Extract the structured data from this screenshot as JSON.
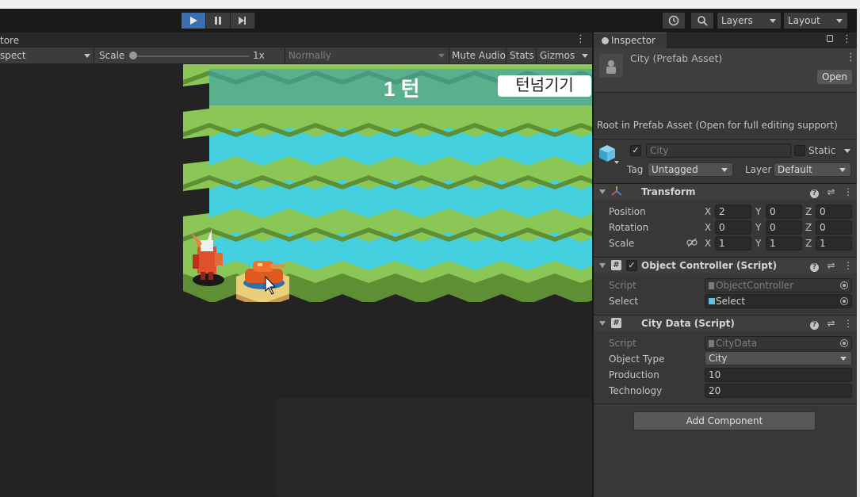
{
  "toolbar": {
    "play_icon": "play-icon",
    "pause_icon": "pause-icon",
    "step_icon": "step-icon",
    "history_icon": "history-icon",
    "search_icon": "search-icon",
    "layers_label": "Layers",
    "layout_label": "Layout"
  },
  "game_view": {
    "tab_label": "tore",
    "aspect_label": "spect",
    "scale_label": "Scale",
    "scale_value": "1x",
    "quality_label": "Normally",
    "mute_label": "Mute Audio",
    "stats_label": "Stats",
    "gizmos_label": "Gizmos",
    "turn_text": "1 턴",
    "skip_button": "턴넘기기"
  },
  "inspector": {
    "tab_label": "Inspector",
    "header_title": "City (Prefab Asset)",
    "open_button": "Open",
    "root_message": "Root in Prefab Asset (Open for full editing support)",
    "object_name": "City",
    "active": true,
    "static_label": "Static",
    "tag_label": "Tag",
    "tag_value": "Untagged",
    "layer_label": "Layer",
    "layer_value": "Default",
    "transform": {
      "title": "Transform",
      "position_label": "Position",
      "rotation_label": "Rotation",
      "scale_label": "Scale",
      "axis_x": "X",
      "axis_y": "Y",
      "axis_z": "Z",
      "position": {
        "x": "2",
        "y": "0",
        "z": "0"
      },
      "rotation": {
        "x": "0",
        "y": "0",
        "z": "0"
      },
      "scale": {
        "x": "1",
        "y": "1",
        "z": "1"
      }
    },
    "object_controller": {
      "title": "Object Controller (Script)",
      "script_label": "Script",
      "script_value": "ObjectController",
      "select_label": "Select",
      "select_value": "Select"
    },
    "city_data": {
      "title": "City Data (Script)",
      "script_label": "Script",
      "script_value": "CityData",
      "object_type_label": "Object Type",
      "object_type_value": "City",
      "production_label": "Production",
      "production_value": "10",
      "technology_label": "Technology",
      "technology_value": "20"
    },
    "add_component": "Add Component"
  },
  "colors": {
    "grass": "#8bc756",
    "grass_dark": "#5f8f35",
    "water": "#44d0de",
    "accent": "#3a6fb0",
    "panel": "#383838"
  }
}
